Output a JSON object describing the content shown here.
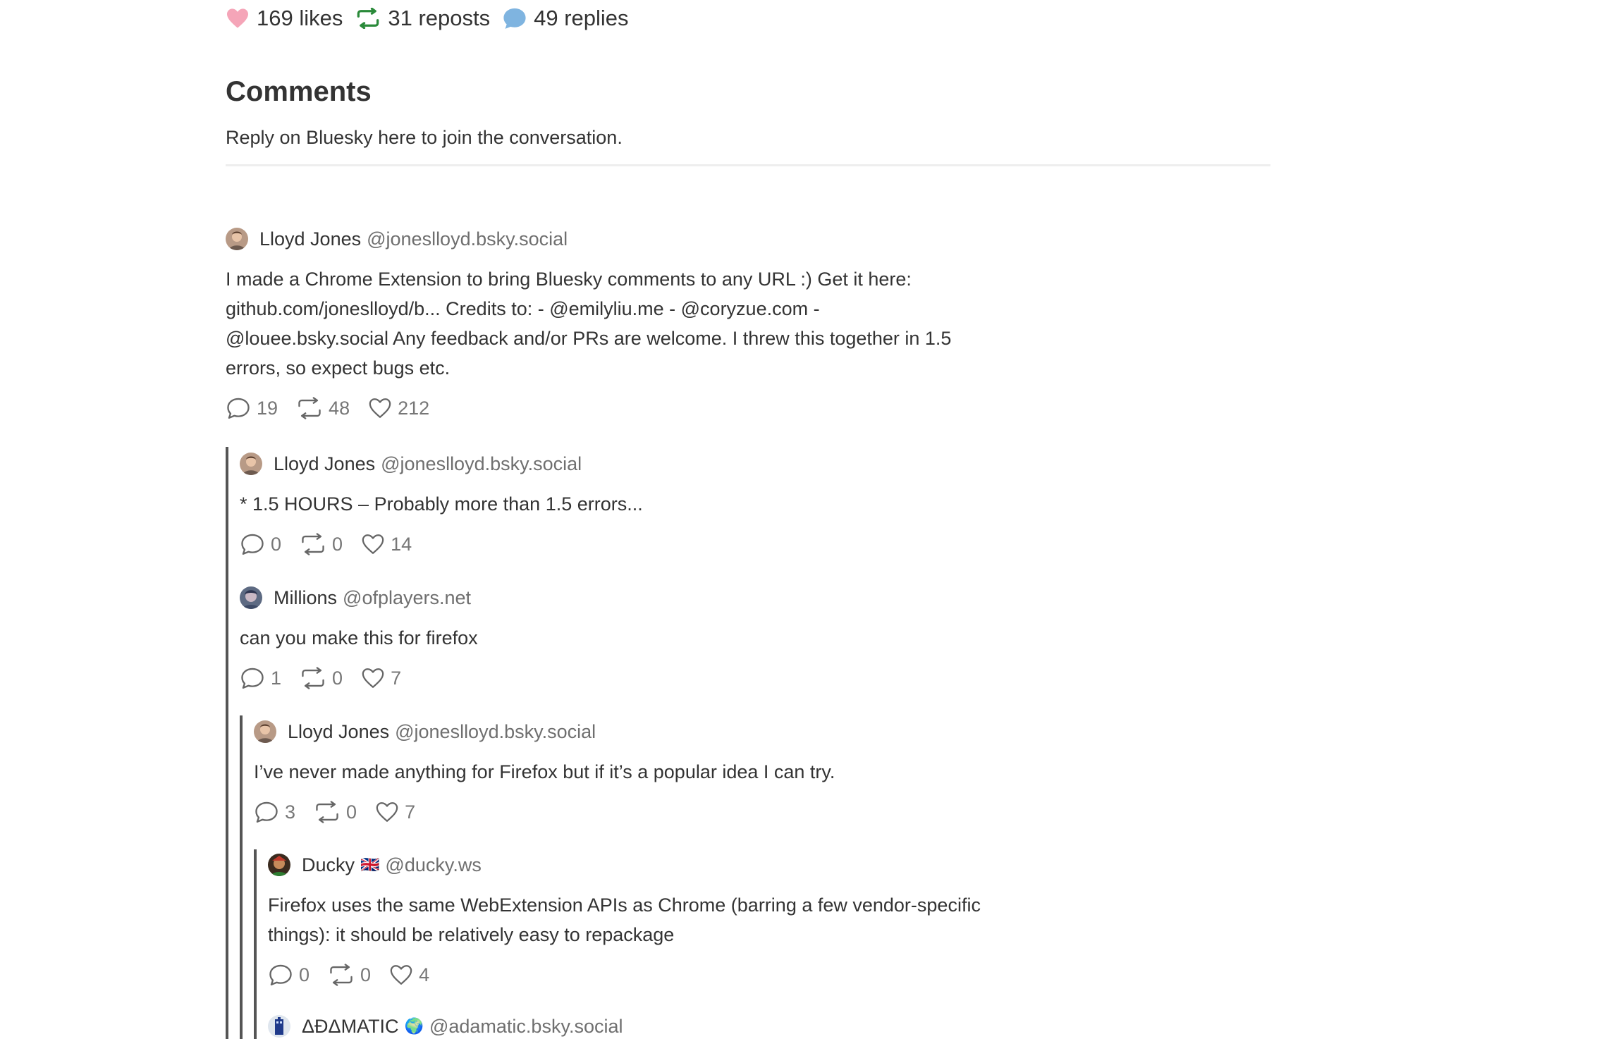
{
  "stats": {
    "likes": "169 likes",
    "reposts": "31 reposts",
    "replies": "49 replies"
  },
  "comments_section": {
    "heading": "Comments",
    "subtitle": "Reply on Bluesky here to join the conversation."
  },
  "comments": [
    {
      "name": "Lloyd Jones",
      "handle": "@joneslloyd.bsky.social",
      "flag": "",
      "text_lines": [
        "I made a Chrome Extension to bring Bluesky comments to any URL :) Get it here:",
        "github.com/joneslloyd/b... Credits to: - @emilyliu.me - @coryzue.com -",
        "@louee.bsky.social Any feedback and/or PRs are welcome. I threw this together in 1.5",
        "errors, so expect bugs etc."
      ],
      "replies": "19",
      "reposts": "48",
      "likes": "212"
    },
    {
      "name": "Lloyd Jones",
      "handle": "@joneslloyd.bsky.social",
      "flag": "",
      "text_lines": [
        "* 1.5 HOURS – Probably more than 1.5 errors..."
      ],
      "replies": "0",
      "reposts": "0",
      "likes": "14"
    },
    {
      "name": "Millions",
      "handle": "@ofplayers.net",
      "flag": "",
      "text_lines": [
        "can you make this for firefox"
      ],
      "replies": "1",
      "reposts": "0",
      "likes": "7"
    },
    {
      "name": "Lloyd Jones",
      "handle": "@joneslloyd.bsky.social",
      "flag": "",
      "text_lines": [
        "I’ve never made anything for Firefox but if it’s a popular idea I can try."
      ],
      "replies": "3",
      "reposts": "0",
      "likes": "7"
    },
    {
      "name": "Ducky",
      "handle": "@ducky.ws",
      "flag": "🇬🇧",
      "text_lines": [
        "Firefox uses the same WebExtension APIs as Chrome (barring a few vendor-specific",
        "things): it should be relatively easy to repackage"
      ],
      "replies": "0",
      "reposts": "0",
      "likes": "4"
    },
    {
      "name": "ΔÐΔMATIC",
      "handle": "@adamatic.bsky.social",
      "flag": "🌍",
      "text_lines": [],
      "replies": "",
      "reposts": "",
      "likes": ""
    }
  ],
  "colors": {
    "heart_pink": "#f5a5b8",
    "repost_green": "#2a8a3a",
    "reply_blue": "#7fb4e0",
    "thread_line": "#555555",
    "muted_text": "#6f6f6f"
  },
  "icons": {
    "likes": "heart-icon",
    "reposts": "repost-icon",
    "replies": "speech-bubble-icon"
  }
}
